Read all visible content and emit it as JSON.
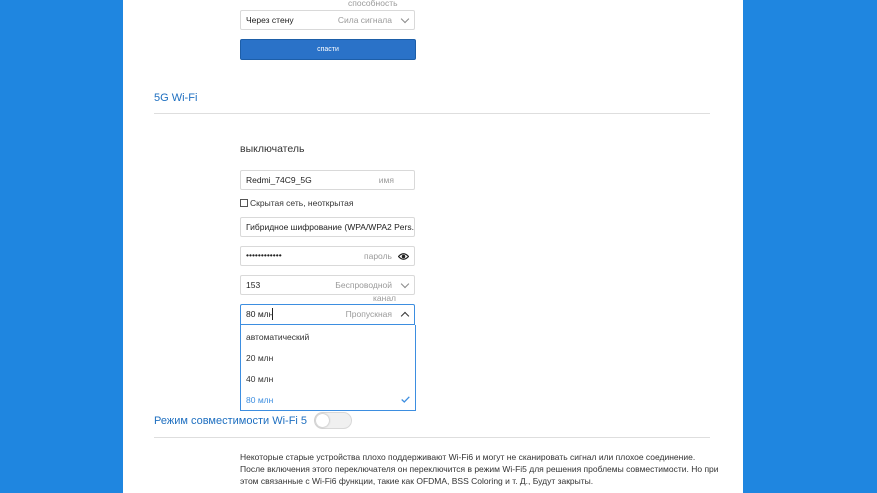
{
  "top_section": {
    "capacity_label": "способность",
    "wall_select": {
      "value": "Через стену",
      "placeholder": "Сила сигнала"
    },
    "save_label": "спасти"
  },
  "wifi5g": {
    "title": "5G Wi-Fi",
    "switch_label": "выключатель",
    "ssid": {
      "value": "Redmi_74C9_5G",
      "placeholder": "имя"
    },
    "hidden_label": "Скрытая сеть, неоткрытая",
    "encryption": {
      "value": "Гибридное шифрование (WPA/WPA2 Pers..."
    },
    "password": {
      "value": "••••••••••••",
      "placeholder": "пароль"
    },
    "channel": {
      "value": "153",
      "placeholder_line1": "Беспроводной",
      "placeholder_line2": "канал"
    },
    "bandwidth": {
      "value": "80 млн",
      "placeholder": "Пропускная"
    },
    "bandwidth_options": [
      {
        "label": "автоматический"
      },
      {
        "label": "20 млн"
      },
      {
        "label": "40 млн"
      },
      {
        "label": "80 млн"
      }
    ]
  },
  "compat": {
    "title": "Режим совместимости Wi-Fi 5",
    "enabled": false,
    "desc_line1": "Некоторые старые устройства плохо поддерживают Wi-Fi6 и могут не сканировать сигнал или плохое соединение.",
    "desc_line2": "После включения этого переключателя он переключится в режим Wi-Fi5 для решения проблемы совместимости. Но при",
    "desc_line3": "этом связанные с Wi-Fi6 функции, такие как OFDMA, BSS Coloring и т. Д., Будут закрыты."
  },
  "colors": {
    "background": "#1f86e0",
    "accent": "#2a72c8",
    "selected": "#3d8ee0"
  }
}
